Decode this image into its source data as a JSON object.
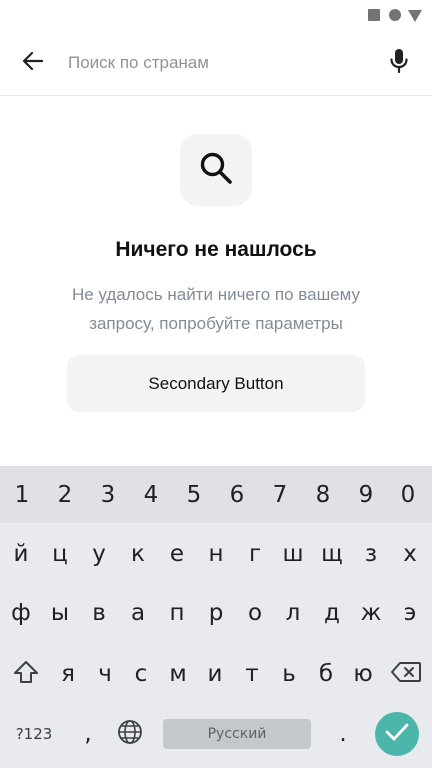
{
  "header": {
    "search_placeholder": "Поиск по странам"
  },
  "empty_state": {
    "title": "Ничего не нашлось",
    "description": "Не удалось найти ничего по вашему запросу, попробуйте параметры",
    "button_label": "Secondary Button"
  },
  "keyboard": {
    "numbers": [
      "1",
      "2",
      "3",
      "4",
      "5",
      "6",
      "7",
      "8",
      "9",
      "0"
    ],
    "row1": [
      "й",
      "ц",
      "у",
      "к",
      "е",
      "н",
      "г",
      "ш",
      "щ",
      "з",
      "х"
    ],
    "row2": [
      "ф",
      "ы",
      "в",
      "а",
      "п",
      "р",
      "о",
      "л",
      "д",
      "ж",
      "э"
    ],
    "row3": [
      "я",
      "ч",
      "с",
      "м",
      "и",
      "т",
      "ь",
      "б",
      "ю"
    ],
    "symbols_label": "?123",
    "comma_label": ",",
    "space_label": "Русский",
    "period_label": "."
  },
  "colors": {
    "accent_enter": "#4db6ac",
    "muted_text": "#818c99"
  },
  "icons": {
    "back": "arrow-left-icon",
    "mic": "microphone-icon",
    "search": "search-icon",
    "shift": "shift-icon",
    "backspace": "backspace-icon",
    "globe": "globe-icon",
    "enter": "check-icon"
  }
}
